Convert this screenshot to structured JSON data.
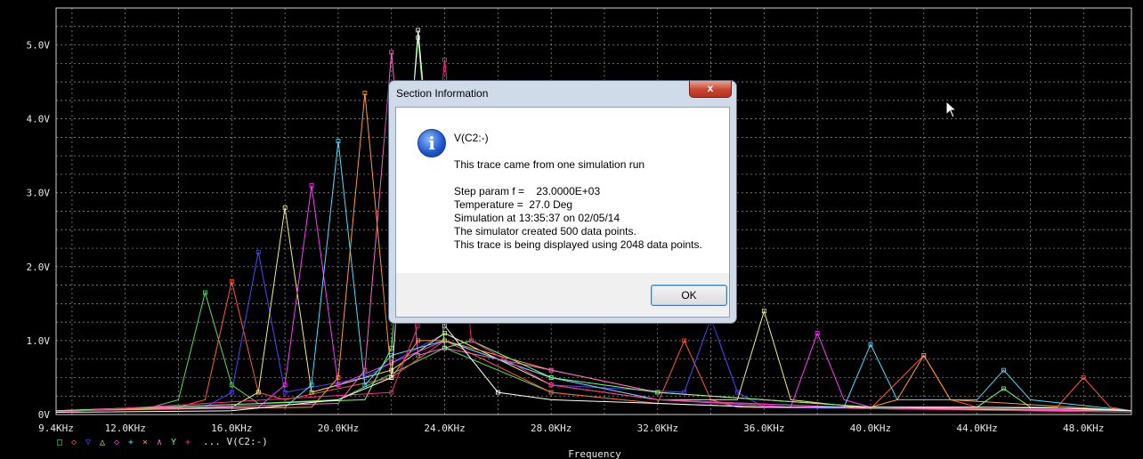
{
  "chart_data": {
    "type": "line",
    "xlabel": "Frequency",
    "x_ticks": [
      "9.4KHz",
      "12.0KHz",
      "16.0KHz",
      "20.0KHz",
      "24.0KHz",
      "28.0KHz",
      "32.0KHz",
      "36.0KHz",
      "40.0KHz",
      "44.0KHz",
      "48.0KHz"
    ],
    "x_tick_values": [
      9.4,
      12,
      16,
      20,
      24,
      28,
      32,
      36,
      40,
      44,
      48
    ],
    "y_ticks": [
      "0V",
      "1.0V",
      "2.0V",
      "3.0V",
      "4.0V",
      "5.0V"
    ],
    "y_tick_values": [
      0,
      1,
      2,
      3,
      4,
      5
    ],
    "xlim": [
      9.4,
      49.8
    ],
    "ylim": [
      0,
      5.5
    ],
    "grid": true,
    "legend_placement": "bottom-left",
    "legend_label": "...  V(C2:-)",
    "series": [
      {
        "color": "#5ade5a",
        "x": [
          9.4,
          13,
          14,
          15,
          16,
          17,
          20,
          24,
          28,
          32,
          36,
          40,
          44,
          48,
          49.8
        ],
        "y": [
          0.05,
          0.1,
          0.2,
          1.65,
          0.4,
          0.15,
          0.2,
          0.9,
          0.3,
          0.15,
          0.1,
          0.08,
          0.08,
          0.05,
          0.05
        ]
      },
      {
        "color": "#ff5a3a",
        "x": [
          9.4,
          14,
          15,
          16,
          17,
          18,
          22,
          24,
          28,
          32,
          33,
          34,
          35,
          40,
          42,
          43,
          44,
          47,
          48,
          49,
          49.8
        ],
        "y": [
          0.05,
          0.1,
          0.2,
          1.8,
          0.3,
          0.2,
          0.5,
          1.0,
          0.3,
          0.15,
          1.0,
          0.2,
          0.1,
          0.08,
          0.8,
          0.2,
          0.1,
          0.1,
          0.5,
          0.1,
          0.05
        ]
      },
      {
        "color": "#4a4aff",
        "x": [
          9.4,
          15,
          16,
          17,
          18,
          21,
          24,
          28,
          33,
          34,
          35,
          36,
          40,
          49.8
        ],
        "y": [
          0.05,
          0.1,
          0.3,
          2.2,
          0.3,
          0.5,
          1.1,
          0.4,
          0.3,
          1.3,
          0.3,
          0.1,
          0.08,
          0.05
        ]
      },
      {
        "color": "#f0f080",
        "x": [
          9.4,
          16,
          17,
          18,
          19,
          22,
          24,
          28,
          32,
          35,
          36,
          37,
          40,
          49.8
        ],
        "y": [
          0.05,
          0.1,
          0.3,
          2.8,
          0.3,
          0.6,
          1.1,
          0.4,
          0.2,
          0.2,
          1.4,
          0.2,
          0.08,
          0.05
        ]
      },
      {
        "color": "#ff3aff",
        "x": [
          9.4,
          17,
          18,
          19,
          20,
          22,
          24,
          28,
          32,
          37,
          38,
          39,
          40,
          49.8
        ],
        "y": [
          0.05,
          0.1,
          0.4,
          3.1,
          0.4,
          0.7,
          1.0,
          0.5,
          0.2,
          0.1,
          1.1,
          0.2,
          0.1,
          0.05
        ]
      },
      {
        "color": "#4ae0ff",
        "x": [
          9.4,
          18,
          19,
          20,
          21,
          22,
          24,
          28,
          32,
          39,
          40,
          41,
          44,
          45,
          46,
          49.8
        ],
        "y": [
          0.05,
          0.1,
          0.4,
          3.7,
          0.4,
          0.8,
          1.0,
          0.5,
          0.2,
          0.1,
          0.95,
          0.2,
          0.2,
          0.6,
          0.2,
          0.05
        ]
      },
      {
        "color": "#ff9a3a",
        "x": [
          9.4,
          19,
          20,
          21,
          22,
          23,
          24,
          28,
          32,
          40,
          41,
          42,
          43,
          49.8
        ],
        "y": [
          0.05,
          0.1,
          0.5,
          4.35,
          0.5,
          1.0,
          1.0,
          0.6,
          0.3,
          0.1,
          0.2,
          0.8,
          0.2,
          0.05
        ]
      },
      {
        "color": "#ff66cc",
        "x": [
          9.4,
          20,
          21,
          22,
          23,
          24,
          28,
          32,
          40,
          49.8
        ],
        "y": [
          0.05,
          0.15,
          0.6,
          4.9,
          0.8,
          0.9,
          0.6,
          0.3,
          0.1,
          0.05
        ]
      },
      {
        "color": "#7aff7a",
        "x": [
          9.4,
          21,
          22,
          23,
          24,
          25,
          28,
          32,
          40,
          44,
          45,
          46,
          49.8
        ],
        "y": [
          0.05,
          0.2,
          0.9,
          5.1,
          0.9,
          1.0,
          0.5,
          0.3,
          0.1,
          0.1,
          0.35,
          0.1,
          0.05
        ]
      },
      {
        "color": "#ff2a8a",
        "x": [
          9.4,
          22,
          23,
          24,
          25,
          28,
          32,
          40,
          49.8
        ],
        "y": [
          0.03,
          0.3,
          1.2,
          4.8,
          1.0,
          0.4,
          0.2,
          0.08,
          0.03
        ]
      },
      {
        "color": "#ffffff",
        "x": [
          9.4,
          16,
          20,
          22,
          23,
          24,
          26,
          28,
          32,
          36,
          40,
          44,
          48,
          49.8
        ],
        "y": [
          0.03,
          0.05,
          0.2,
          0.5,
          5.2,
          1.2,
          0.3,
          0.2,
          0.15,
          0.1,
          0.1,
          0.1,
          0.08,
          0.05
        ]
      }
    ]
  },
  "legend_markers": [
    {
      "symbol": "□",
      "color": "#5ade5a"
    },
    {
      "symbol": "◇",
      "color": "#ff5a3a"
    },
    {
      "symbol": "▽",
      "color": "#4a4aff"
    },
    {
      "symbol": "△",
      "color": "#f0f080"
    },
    {
      "symbol": "◇",
      "color": "#ff3aff"
    },
    {
      "symbol": "+",
      "color": "#4ae0ff"
    },
    {
      "symbol": "×",
      "color": "#ff9a3a"
    },
    {
      "symbol": "∧",
      "color": "#ff66cc"
    },
    {
      "symbol": "Y",
      "color": "#7aff7a"
    },
    {
      "symbol": "+",
      "color": "#ff2a8a"
    }
  ],
  "dialog": {
    "title": "Section Information",
    "close_label": "x",
    "icon": "info-icon",
    "trace_name": "V(C2:-)",
    "line1": "This trace came from one simulation run",
    "step_param": "Step param f =    23.0000E+03",
    "temperature": "Temperature =  27.0 Deg",
    "simulation_at": "Simulation at 13:35:37 on 02/05/14",
    "created_points": "The simulator created 500 data points.",
    "display_points": "This trace is being displayed using 2048 data points.",
    "ok_label": "OK"
  }
}
